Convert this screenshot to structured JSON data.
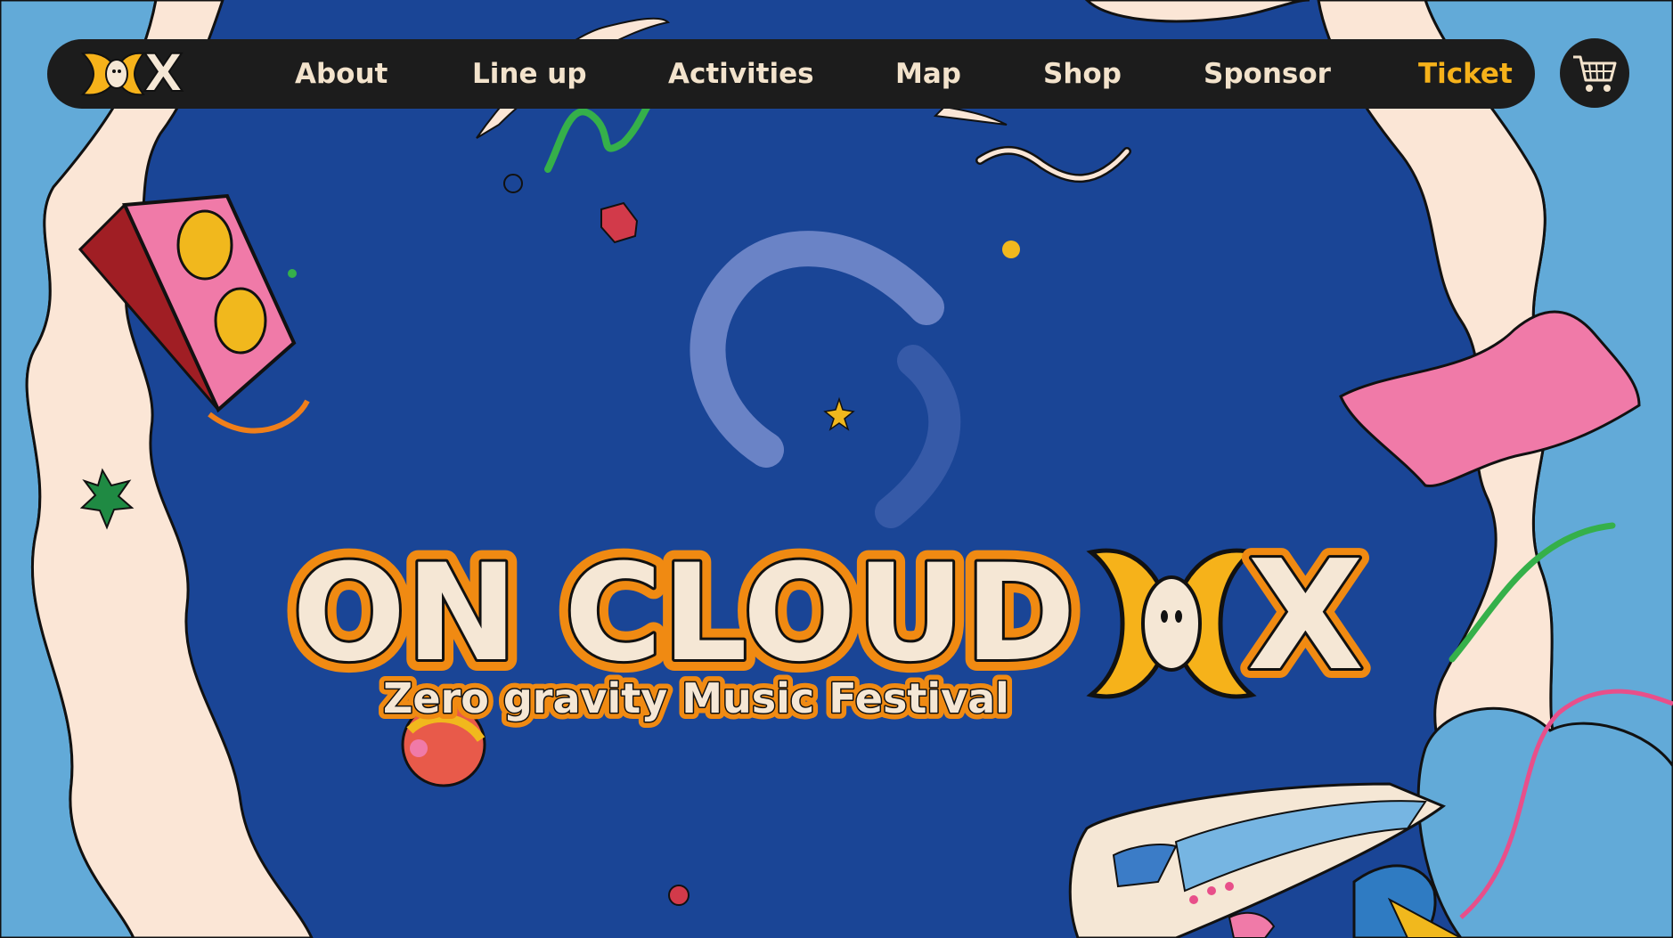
{
  "colors": {
    "background": "#1a4596",
    "navbar": "#1c1c1c",
    "nav_text": "#f3e3cc",
    "ticket_accent": "#f6b21a",
    "title_fill": "#f5e7d5",
    "title_outline": "#f08a12",
    "cloud_cream": "#fbe6d6",
    "sky_blue": "#62aad8"
  },
  "nav": {
    "logo_text": "X",
    "items": [
      {
        "label": "About"
      },
      {
        "label": "Line up"
      },
      {
        "label": "Activities"
      },
      {
        "label": "Map"
      },
      {
        "label": "Shop"
      },
      {
        "label": "Sponsor"
      },
      {
        "label": "Ticket"
      }
    ],
    "cart_icon": "shopping-cart-icon"
  },
  "hero": {
    "title": "ON CLOUD",
    "title_mark": "X",
    "subtitle": "Zero gravity Music Festival"
  }
}
